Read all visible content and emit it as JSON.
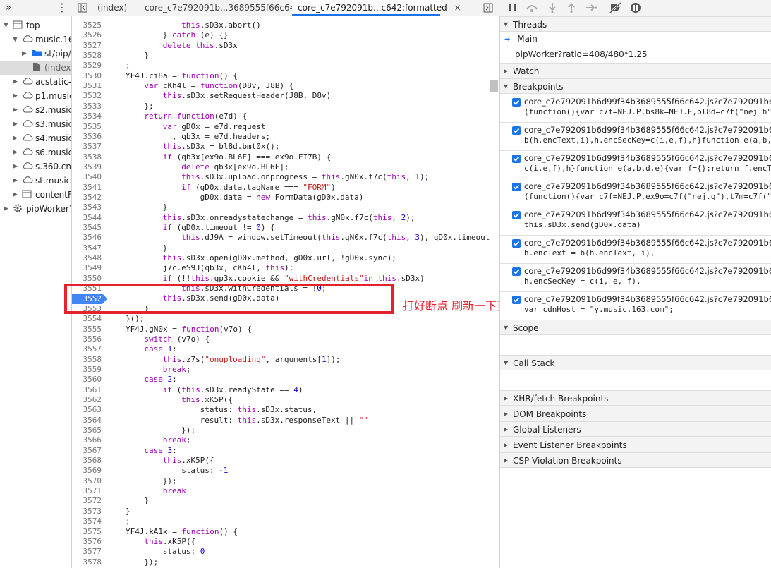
{
  "topbar": {
    "more_tabs": "»",
    "tabs": [
      "(index)",
      "core_c7e792091b...3689555f66c642",
      "core_c7e792091b...c642:formatted"
    ],
    "close": "×"
  },
  "sidebar": {
    "items": [
      {
        "label": "top",
        "tw": "▼",
        "icon": "frame"
      },
      {
        "label": "music.163.com",
        "tw": "▼",
        "icon": "cloud"
      },
      {
        "label": "st/pip/",
        "tw": "▶",
        "icon": "folder"
      },
      {
        "label": "(index)",
        "tw": "",
        "icon": "file"
      },
      {
        "label": "acstatic-dun",
        "tw": "▶",
        "icon": "cloud"
      },
      {
        "label": "p1.music.126",
        "tw": "▶",
        "icon": "cloud"
      },
      {
        "label": "s2.music.126",
        "tw": "▶",
        "icon": "cloud"
      },
      {
        "label": "s3.music.126",
        "tw": "▶",
        "icon": "cloud"
      },
      {
        "label": "s4.music.126",
        "tw": "▶",
        "icon": "cloud"
      },
      {
        "label": "s6.music.126",
        "tw": "▶",
        "icon": "cloud"
      },
      {
        "label": "s.360.cn",
        "tw": "▶",
        "icon": "cloud"
      },
      {
        "label": "st.music.163",
        "tw": "▶",
        "icon": "cloud"
      },
      {
        "label": "contentFrame",
        "tw": "▶",
        "icon": "frame"
      },
      {
        "label": "pipWorker?ratio",
        "tw": "▶",
        "icon": "gear"
      }
    ]
  },
  "editor": {
    "lines": [
      {
        "n": "3525",
        "code": "this.sD3x.abort()",
        "indent": 12
      },
      {
        "n": "3526",
        "code": "} catch (e) {}",
        "indent": 8
      },
      {
        "n": "3527",
        "code": "delete this.sD3x",
        "indent": 8
      },
      {
        "n": "3528",
        "code": "}",
        "indent": 4
      },
      {
        "n": "3529",
        "code": ";",
        "indent": 0
      },
      {
        "n": "3530",
        "code": "YF4J.ci8a = function() {",
        "indent": 0
      },
      {
        "n": "3531",
        "code": "var cKh4l = function(D8v, J8B) {",
        "indent": 4
      },
      {
        "n": "3532",
        "code": "this.sD3x.setRequestHeader(J8B, D8v)",
        "indent": 8
      },
      {
        "n": "3533",
        "code": "};",
        "indent": 4
      },
      {
        "n": "3534",
        "code": "return function(e7d) {",
        "indent": 4
      },
      {
        "n": "3535",
        "code": "var gD0x = e7d.request",
        "indent": 8
      },
      {
        "n": "3536",
        "code": ", qb3x = e7d.headers;",
        "indent": 10
      },
      {
        "n": "3537",
        "code": "this.sD3x = bl8d.bmt0x();",
        "indent": 8
      },
      {
        "n": "3538",
        "code": "if (qb3x[ex9o.BL6F] === ex9o.FI7B) {",
        "indent": 8
      },
      {
        "n": "3539",
        "code": "delete qb3x[ex9o.BL6F];",
        "indent": 12
      },
      {
        "n": "3540",
        "code": "this.sD3x.upload.onprogress = this.gN0x.f7c(this, 1);",
        "indent": 12
      },
      {
        "n": "3541",
        "code": "if (gD0x.data.tagName === \"FORM\")",
        "indent": 12
      },
      {
        "n": "3542",
        "code": "gD0x.data = new FormData(gD0x.data)",
        "indent": 16
      },
      {
        "n": "3543",
        "code": "}",
        "indent": 8
      },
      {
        "n": "3544",
        "code": "this.sD3x.onreadystatechange = this.gN0x.f7c(this, 2);",
        "indent": 8
      },
      {
        "n": "3545",
        "code": "if (gD0x.timeout != 0) {",
        "indent": 8
      },
      {
        "n": "3546",
        "code": "this.dJ9A = window.setTimeout(this.gN0x.f7c(this, 3), gD0x.timeout",
        "indent": 12
      },
      {
        "n": "3547",
        "code": "}",
        "indent": 8
      },
      {
        "n": "3548",
        "code": "this.sD3x.open(gD0x.method, gD0x.url, !gD0x.sync);",
        "indent": 8
      },
      {
        "n": "3549",
        "code": "j7c.eS9J(qb3x, cKh4l, this);",
        "indent": 8
      },
      {
        "n": "3550",
        "code": "if (!!this.qp3x.cookie && \"withCredentials\"in this.sD3x)",
        "indent": 8
      },
      {
        "n": "3551",
        "code": "this.sD3x.withCredentials = !0;",
        "indent": 12
      },
      {
        "n": "3552",
        "code": "this.sD3x.send(gD0x.data)",
        "indent": 8
      },
      {
        "n": "3553",
        "code": "}",
        "indent": 4
      },
      {
        "n": "3554",
        "code": "}();",
        "indent": 0
      },
      {
        "n": "3555",
        "code": "YF4J.gN0x = function(v7o) {",
        "indent": 0
      },
      {
        "n": "3556",
        "code": "switch (v7o) {",
        "indent": 4
      },
      {
        "n": "3557",
        "code": "case 1:",
        "indent": 4
      },
      {
        "n": "3558",
        "code": "this.z7s(\"onuploading\", arguments[1]);",
        "indent": 8
      },
      {
        "n": "3559",
        "code": "break;",
        "indent": 8
      },
      {
        "n": "3560",
        "code": "case 2:",
        "indent": 4
      },
      {
        "n": "3561",
        "code": "if (this.sD3x.readyState == 4)",
        "indent": 8
      },
      {
        "n": "3562",
        "code": "this.xK5P({",
        "indent": 12
      },
      {
        "n": "3563",
        "code": "status: this.sD3x.status,",
        "indent": 16
      },
      {
        "n": "3564",
        "code": "result: this.sD3x.responseText || \"\"",
        "indent": 16
      },
      {
        "n": "3565",
        "code": "});",
        "indent": 12
      },
      {
        "n": "3566",
        "code": "break;",
        "indent": 8
      },
      {
        "n": "3567",
        "code": "case 3:",
        "indent": 4
      },
      {
        "n": "3568",
        "code": "this.xK5P({",
        "indent": 8
      },
      {
        "n": "3569",
        "code": "status: -1",
        "indent": 12
      },
      {
        "n": "3570",
        "code": "});",
        "indent": 8
      },
      {
        "n": "3571",
        "code": "break",
        "indent": 8
      },
      {
        "n": "3572",
        "code": "}",
        "indent": 4
      },
      {
        "n": "3573",
        "code": "}",
        "indent": 0
      },
      {
        "n": "3574",
        "code": ";",
        "indent": 0
      },
      {
        "n": "3575",
        "code": "YF4J.kA1x = function() {",
        "indent": 0
      },
      {
        "n": "3576",
        "code": "this.xK5P({",
        "indent": 4
      },
      {
        "n": "3577",
        "code": "status: 0",
        "indent": 8
      },
      {
        "n": "3578",
        "code": "});",
        "indent": 4
      }
    ],
    "breakpoint_line": "3552"
  },
  "annotation": "打好断点 刷新一下页面",
  "right": {
    "threads": {
      "title": "Threads",
      "main": "Main",
      "worker": "pipWorker?ratio=408/480*1.25"
    },
    "watch": "Watch",
    "breakpoints": {
      "title": "Breakpoints",
      "items": [
        {
          "file": "core_c7e792091b6d99f34b3689555f66c642.js?c7e792091b6d99f34",
          "code": "(function(){var c7f=NEJ.P,bs8k=NEJ.F,bl8d=c7f(\"nej.h\""
        },
        {
          "file": "core_c7e792091b6d99f34b3689555f66c642.js?c7e792091b6d99f34",
          "code": "b(h.encText,i),h.encSecKey=c(i,e,f),h}function e(a,b,"
        },
        {
          "file": "core_c7e792091b6d99f34b3689555f66c642.js?c7e792091b6d99f34",
          "code": "c(i,e,f),h}function e(a,b,d,e){var f={};return f.encT"
        },
        {
          "file": "core_c7e792091b6d99f34b3689555f66c642.js?c7e792091b6d99f34",
          "code": "(function(){var c7f=NEJ.P,ex9o=c7f(\"nej.g\"),t7m=c7f(\""
        },
        {
          "file": "core_c7e792091b6d99f34b3689555f66c642.js?c7e792091b6d99f34",
          "code": "this.sD3x.send(gD0x.data)"
        },
        {
          "file": "core_c7e792091b6d99f34b3689555f66c642.js?c7e792091b6d99f34",
          "code": "h.encText = b(h.encText, i),"
        },
        {
          "file": "core_c7e792091b6d99f34b3689555f66c642.js?c7e792091b6d99f34",
          "code": "h.encSecKey = c(i, e, f),"
        },
        {
          "file": "core_c7e792091b6d99f34b3689555f66c642.js?c7e792091b6d99f34",
          "code": "var cdnHost = \"y.music.163.com\";"
        }
      ]
    },
    "scope": "Scope",
    "call_stack": "Call Stack",
    "panes": [
      "XHR/fetch Breakpoints",
      "DOM Breakpoints",
      "Global Listeners",
      "Event Listener Breakpoints",
      "CSP Violation Breakpoints"
    ]
  },
  "colors": {
    "accent": "#1a73e8",
    "annotation": "#e5222b",
    "keyword": "#9b00b0",
    "string": "#c41a16"
  }
}
